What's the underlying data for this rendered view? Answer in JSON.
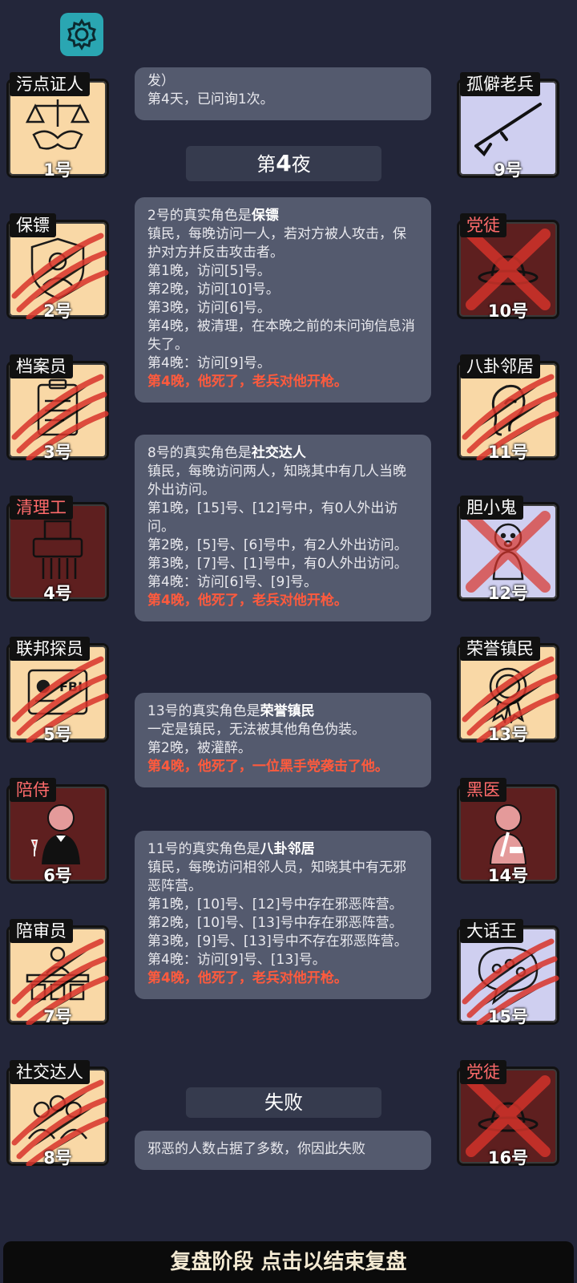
{
  "header": {
    "settings_icon": "gear-icon"
  },
  "left_cards": [
    {
      "role": "污点证人",
      "number": "1号",
      "icon": "justice-scale-icon",
      "alignment": "town",
      "dead": false
    },
    {
      "role": "保镖",
      "number": "2号",
      "icon": "bodyguard-shield-icon",
      "alignment": "town",
      "dead": true
    },
    {
      "role": "档案员",
      "number": "3号",
      "icon": "clipboard-icon",
      "alignment": "town",
      "dead": true
    },
    {
      "role": "清理工",
      "number": "4号",
      "icon": "shredder-icon",
      "alignment": "evil",
      "dead": false
    },
    {
      "role": "联邦探员",
      "number": "5号",
      "icon": "fbi-badge-icon",
      "alignment": "town",
      "dead": true
    },
    {
      "role": "陪侍",
      "number": "6号",
      "icon": "waiter-icon",
      "alignment": "evil",
      "dead": false
    },
    {
      "role": "陪审员",
      "number": "7号",
      "icon": "jury-box-icon",
      "alignment": "town",
      "dead": true
    },
    {
      "role": "社交达人",
      "number": "8号",
      "icon": "social-group-icon",
      "alignment": "town",
      "dead": true
    }
  ],
  "right_cards": [
    {
      "role": "孤僻老兵",
      "number": "9号",
      "icon": "rifle-icon",
      "alignment": "neutral",
      "dead": false
    },
    {
      "role": "党徒",
      "number": "10号",
      "icon": "hat-icon",
      "alignment": "evil",
      "dead": true
    },
    {
      "role": "八卦邻居",
      "number": "11号",
      "icon": "ear-icon",
      "alignment": "town",
      "dead": true
    },
    {
      "role": "胆小鬼",
      "number": "12号",
      "icon": "scared-figure-icon",
      "alignment": "neutral",
      "dead": true
    },
    {
      "role": "荣誉镇民",
      "number": "13号",
      "icon": "medal-icon",
      "alignment": "town",
      "dead": true
    },
    {
      "role": "黑医",
      "number": "14号",
      "icon": "doctor-knife-icon",
      "alignment": "evil",
      "dead": false
    },
    {
      "role": "大话王",
      "number": "15号",
      "icon": "speech-bubble-icon",
      "alignment": "neutral",
      "dead": true
    },
    {
      "role": "党徒",
      "number": "16号",
      "icon": "hat-icon",
      "alignment": "evil",
      "dead": true
    }
  ],
  "log": {
    "top_partial": [
      "发）",
      "第4天，已问询1次。"
    ],
    "night_header": {
      "prefix": "第",
      "num": "4",
      "suffix": "夜"
    },
    "msg1": {
      "title_prefix": "2号的真实角色是",
      "title_role": "保镖",
      "lines": [
        "镇民，每晚访问一人，若对方被人攻击，保护对方并反击攻击者。",
        "第1晚，访问[5]号。",
        "第2晚，访问[10]号。",
        "第3晚，访问[6]号。",
        "第4晚，被清理，在本晚之前的未问询信息消失了。",
        "第4晚：访问[9]号。"
      ],
      "death": "第4晚，他死了，老兵对他开枪。"
    },
    "msg2": {
      "title_prefix": "8号的真实角色是",
      "title_role": "社交达人",
      "lines": [
        "镇民，每晚访问两人，知晓其中有几人当晚外出访问。",
        "第1晚，[15]号、[12]号中，有0人外出访问。",
        "第2晚，[5]号、[6]号中，有2人外出访问。",
        "第3晚，[7]号、[1]号中，有0人外出访问。",
        "第4晚：访问[6]号、[9]号。"
      ],
      "death": "第4晚，他死了，老兵对他开枪。"
    },
    "msg3": {
      "title_prefix": "13号的真实角色是",
      "title_role": "荣誉镇民",
      "lines": [
        "一定是镇民，无法被其他角色伪装。",
        "第2晚，被灌醉。"
      ],
      "death": "第4晚，他死了，一位黑手党袭击了他。"
    },
    "msg4": {
      "title_prefix": "11号的真实角色是",
      "title_role": "八卦邻居",
      "lines": [
        "镇民，每晚访问相邻人员，知晓其中有无邪恶阵营。",
        "第1晚，[10]号、[12]号中存在邪恶阵营。",
        "第2晚，[10]号、[13]号中存在邪恶阵营。",
        "第3晚，[9]号、[13]号中不存在邪恶阵营。",
        "第4晚：访问[9]号、[13]号。"
      ],
      "death": "第4晚，他死了，老兵对他开枪。"
    },
    "result_header": "失败",
    "result_text": "邪恶的人数占据了多数，你因此失败"
  },
  "bottom_bar": "复盘阶段 点击以结束复盘",
  "colors": {
    "background": "#23263a",
    "message_bg": "#545a6e",
    "death_text": "#ff5a3d",
    "gear_bg": "#2aa6b2",
    "town_card": "#f9d8a6",
    "neutral_card": "#cfcff0",
    "evil_card": "#5e1f1f"
  }
}
